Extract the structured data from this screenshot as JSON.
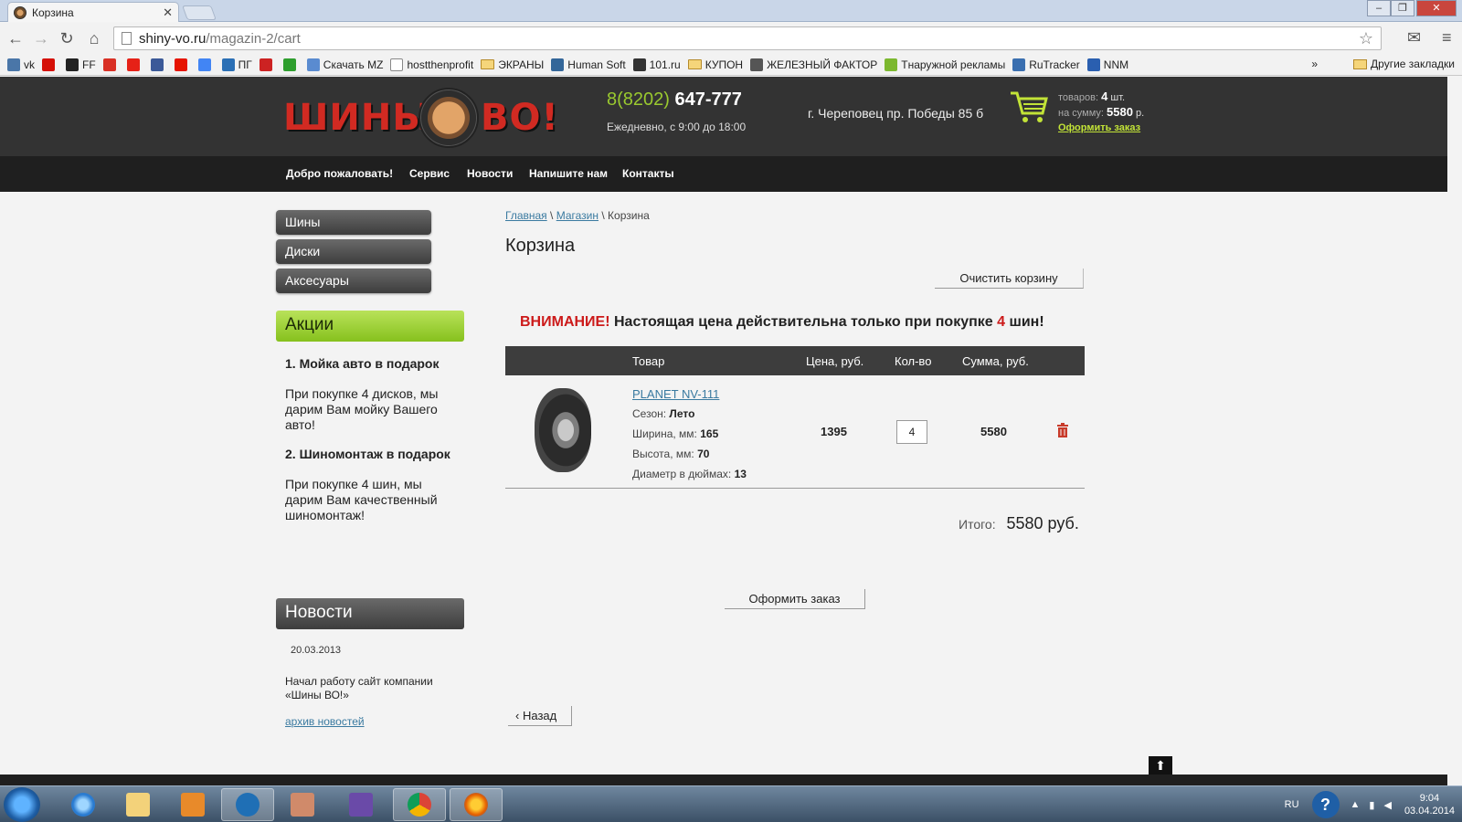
{
  "browser": {
    "tab_title": "Корзина",
    "url_host": "shiny-vo.ru",
    "url_path": "/magazin-2/cart",
    "bookmarks": [
      {
        "label": "vk",
        "icon": "vk-icon",
        "color": "#4a76a8"
      },
      {
        "label": "",
        "icon": "lastfm-icon",
        "color": "#d51007"
      },
      {
        "label": "FF",
        "icon": "ff-icon",
        "color": "#222222"
      },
      {
        "label": "",
        "icon": "gmail-icon",
        "color": "#d93025"
      },
      {
        "label": "",
        "icon": "youtube-icon",
        "color": "#e62117"
      },
      {
        "label": "",
        "icon": "fb-icon",
        "color": "#3b5998"
      },
      {
        "label": "",
        "icon": "yandex-icon",
        "color": "#e61400"
      },
      {
        "label": "",
        "icon": "google-icon",
        "color": "#4285f4"
      },
      {
        "label": "ПГ",
        "icon": "pg-icon",
        "color": "#2a6fb5"
      },
      {
        "label": "",
        "icon": "chart-icon",
        "color": "#cc2222"
      },
      {
        "label": "",
        "icon": "green-icon",
        "color": "#2e9e2e"
      },
      {
        "label": "Скачать MZ",
        "icon": "mz-icon",
        "color": "#5a8bd0"
      },
      {
        "label": "hostthenprofit",
        "icon": "page-icon",
        "color": "#ffffff"
      },
      {
        "label": "ЭКРАНЫ",
        "icon": "folder-icon",
        "color": "#f5d57a"
      },
      {
        "label": "Human Soft",
        "icon": "hs-icon",
        "color": "#336699"
      },
      {
        "label": "101.ru",
        "icon": "play-icon",
        "color": "#333333"
      },
      {
        "label": "КУПОН",
        "icon": "folder-icon",
        "color": "#f5d57a"
      },
      {
        "label": "ЖЕЛЕЗНЫЙ ФАКТОР",
        "icon": "gear-icon",
        "color": "#555555"
      },
      {
        "label": "Тнаружной рекламы",
        "icon": "leaf-icon",
        "color": "#7cb82f"
      },
      {
        "label": "RuTracker",
        "icon": "rutracker-icon",
        "color": "#3a6fb0"
      },
      {
        "label": "NNM",
        "icon": "nnm-icon",
        "color": "#2a5fb0"
      }
    ],
    "bookmarks_more": "»",
    "other_bookmarks": "Другие закладки"
  },
  "site": {
    "logo_left": "ШИНЫ",
    "logo_right": "ВО!",
    "phone_code": "8(8202)",
    "phone_number": "647-777",
    "hours": "Ежедневно, с 9:00 до 18:00",
    "address": "г. Череповец пр. Победы 85 б",
    "cart": {
      "items_label": "товаров:",
      "items_count": "4",
      "items_unit": "шт.",
      "sum_label": "на сумму:",
      "sum_value": "5580",
      "sum_unit": "р.",
      "checkout_link": "Оформить заказ"
    },
    "nav": [
      "Добро пожаловать!",
      "Сервис",
      "Новости",
      "Напишите нам",
      "Контакты"
    ]
  },
  "sidebar": {
    "categories": [
      "Шины",
      "Диски",
      "Аксесуары"
    ],
    "promo_title": "Акции",
    "promos": [
      {
        "title": "1. Мойка авто в подарок",
        "text": "При покупке 4 дисков, мы дарим Вам мойку Вашего авто!"
      },
      {
        "title": "2. Шиномонтаж в подарок",
        "text": "При покупке 4 шин, мы дарим Вам качественный шиномонтаж!"
      }
    ],
    "news_title": "Новости",
    "news_date": "20.03.2013",
    "news_text": "Начал работу сайт компании «Шины ВО!»",
    "news_archive": "архив новостей"
  },
  "main": {
    "breadcrumb": {
      "home": "Главная",
      "shop": "Магазин",
      "sep": "\\",
      "current": "Корзина"
    },
    "title": "Корзина",
    "clear_cart": "Очистить корзину",
    "warning_bold": "ВНИМАНИЕ!",
    "warning_text": "Настоящая цена действительна только при покупке",
    "warning_count": "4",
    "warning_tail": "шин!",
    "columns": [
      "Товар",
      "Цена, руб.",
      "Кол-во",
      "Сумма, руб."
    ],
    "item": {
      "name": "PLANET NV-111",
      "season_label": "Сезон:",
      "season": "Лето",
      "width_label": "Ширина, мм:",
      "width": "165",
      "height_label": "Высота, мм:",
      "height": "70",
      "diameter_label": "Диаметр в дюймах:",
      "diameter": "13",
      "price": "1395",
      "quantity": "4",
      "sum": "5580"
    },
    "total_label": "Итого:",
    "total_value": "5580 руб.",
    "order_button": "Оформить заказ",
    "back_button": "Назад"
  },
  "taskbar": {
    "lang": "RU",
    "time": "9:04",
    "date": "03.04.2014"
  }
}
